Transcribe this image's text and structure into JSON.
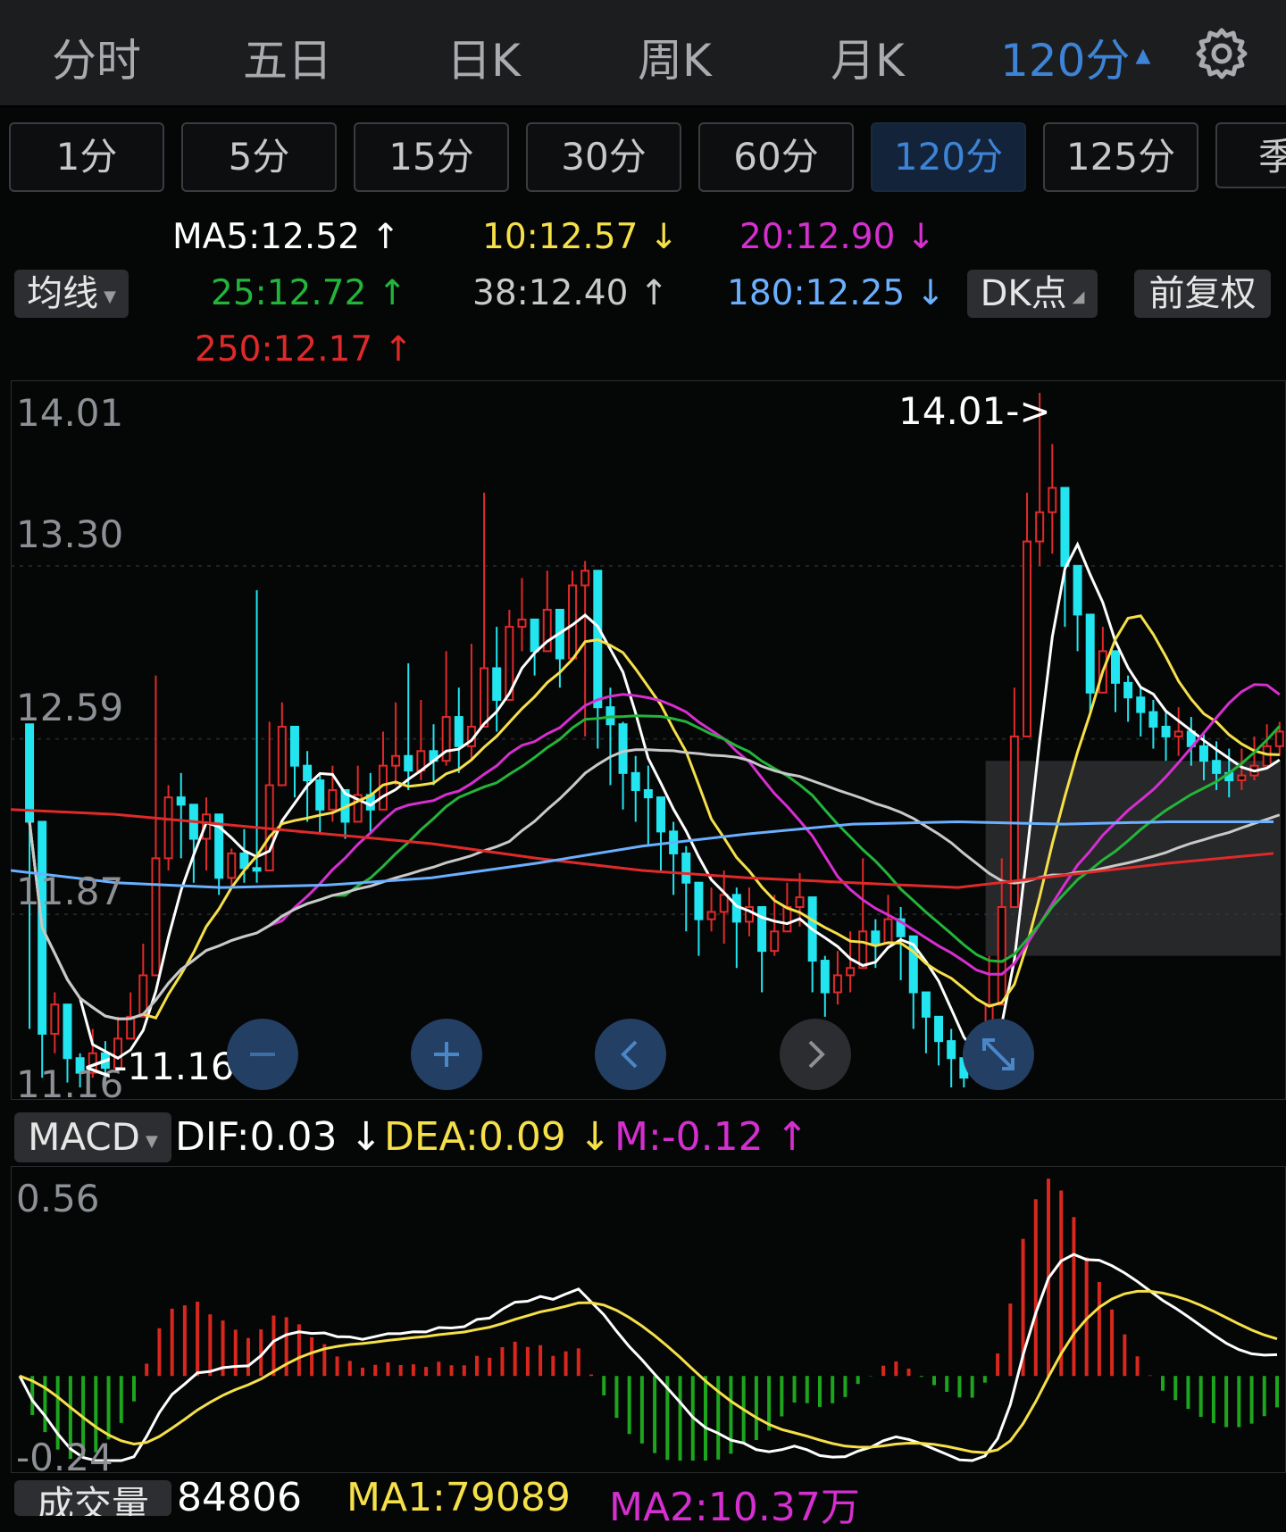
{
  "top_tabs": [
    {
      "label": "分时",
      "active": false
    },
    {
      "label": "五日",
      "active": false
    },
    {
      "label": "日K",
      "active": false
    },
    {
      "label": "周K",
      "active": false
    },
    {
      "label": "月K",
      "active": false
    },
    {
      "label": "120分",
      "active": true
    }
  ],
  "top_caret": "▲",
  "gear_icon": "gear-icon",
  "periods": [
    {
      "label": "1分",
      "active": false
    },
    {
      "label": "5分",
      "active": false
    },
    {
      "label": "15分",
      "active": false
    },
    {
      "label": "30分",
      "active": false
    },
    {
      "label": "60分",
      "active": false
    },
    {
      "label": "120分",
      "active": true
    },
    {
      "label": "125分",
      "active": false
    },
    {
      "label": "季",
      "active": false
    }
  ],
  "ma_legend": {
    "ma5": {
      "text": "MA5:12.52",
      "arrow": "↑",
      "color": "#ffffff"
    },
    "ma10": {
      "text": "10:12.57",
      "arrow": "↓",
      "color": "#f5e04a"
    },
    "ma20": {
      "text": "20:12.90",
      "arrow": "↓",
      "color": "#d52fd0"
    },
    "ma25": {
      "text": "25:12.72",
      "arrow": "↑",
      "color": "#23b53a"
    },
    "ma38": {
      "text": "38:12.40",
      "arrow": "↑",
      "color": "#c9c9c9"
    },
    "ma180": {
      "text": "180:12.25",
      "arrow": "↓",
      "color": "#6ab0ff"
    },
    "ma250": {
      "text": "250:12.17",
      "arrow": "↑",
      "color": "#e02a2a"
    }
  },
  "controls": {
    "avg_line": "均线",
    "dk_point": "DK点",
    "fq": "前复权"
  },
  "main_chart": {
    "y_labels": [
      "14.01",
      "13.30",
      "12.59",
      "11.87",
      "11.16"
    ],
    "max_marker": "14.01->",
    "min_marker": "<-11.16"
  },
  "nav_icons": [
    "minus-icon",
    "plus-icon",
    "chevron-left-icon",
    "chevron-right-icon",
    "expand-icon"
  ],
  "macd": {
    "name": "MACD",
    "dif": {
      "text": "DIF:0.03",
      "arrow": "↓",
      "color": "#ffffff"
    },
    "dea": {
      "text": "DEA:0.09",
      "arrow": "↓",
      "color": "#f5e04a"
    },
    "m": {
      "text": "M:-0.12",
      "arrow": "↑",
      "color": "#d52fd0"
    },
    "y_top": "0.56",
    "y_bottom": "-0.24"
  },
  "volume": {
    "name": "成交量",
    "value": "84806",
    "ma1": "MA1:79089",
    "ma2": "MA2:10.37万"
  },
  "colors": {
    "up": "#e02a2a",
    "down": "#22e5f0",
    "accent": "#3d83d6",
    "macd_pos": "#d8281e",
    "macd_neg": "#1ea51e"
  },
  "chart_data": {
    "type": "candlestick",
    "y_range": [
      11.16,
      14.01
    ],
    "high_marker": 14.01,
    "low_marker": 11.16,
    "ma_last": {
      "MA5": 12.52,
      "MA10": 12.57,
      "MA20": 12.9,
      "MA25": 12.72,
      "MA38": 12.4,
      "MA180": 12.25,
      "MA250": 12.17
    },
    "macd_last": {
      "DIF": 0.03,
      "DEA": 0.09,
      "M": -0.12
    },
    "macd_range": [
      -0.24,
      0.56
    ],
    "closes": [
      12.25,
      11.38,
      11.5,
      11.28,
      11.22,
      11.3,
      11.24,
      11.36,
      11.45,
      11.62,
      12.1,
      12.35,
      12.32,
      12.18,
      12.28,
      12.02,
      12.12,
      12.06,
      12.05,
      12.4,
      12.64,
      12.48,
      12.42,
      12.3,
      12.38,
      12.25,
      12.36,
      12.3,
      12.48,
      12.52,
      12.46,
      12.54,
      12.5,
      12.68,
      12.56,
      12.64,
      12.88,
      12.75,
      13.05,
      13.08,
      12.95,
      13.12,
      12.92,
      13.22,
      13.28,
      12.72,
      12.65,
      12.45,
      12.38,
      12.35,
      12.21,
      12.12,
      12.0,
      11.85,
      11.88,
      11.95,
      11.84,
      11.9,
      11.72,
      11.8,
      11.9,
      11.94,
      11.68,
      11.55,
      11.62,
      11.65,
      11.8,
      11.75,
      11.85,
      11.78,
      11.55,
      11.45,
      11.35,
      11.28,
      11.2,
      11.22,
      11.5,
      11.9,
      12.6,
      13.4,
      13.52,
      13.62,
      13.3,
      13.1,
      12.78,
      12.95,
      12.82,
      12.76,
      12.7,
      12.64,
      12.6,
      12.62,
      12.56,
      12.5,
      12.45,
      12.42,
      12.44,
      12.48,
      12.56,
      12.62
    ],
    "highs": [
      12.3,
      11.55,
      11.55,
      11.4,
      11.3,
      11.4,
      11.35,
      11.45,
      11.55,
      11.75,
      12.85,
      12.4,
      12.45,
      12.32,
      12.35,
      12.12,
      12.14,
      12.22,
      13.2,
      12.66,
      12.74,
      12.5,
      12.54,
      12.45,
      12.48,
      12.38,
      12.48,
      12.45,
      12.62,
      12.74,
      12.9,
      12.75,
      12.65,
      12.95,
      12.8,
      12.98,
      13.6,
      13.05,
      13.12,
      13.25,
      13.05,
      13.28,
      13.05,
      13.28,
      13.32,
      12.92,
      12.8,
      12.66,
      12.52,
      12.48,
      12.35,
      12.25,
      12.15,
      11.95,
      11.98,
      12.05,
      11.98,
      11.98,
      11.85,
      11.95,
      12.0,
      12.04,
      11.8,
      11.7,
      11.72,
      11.8,
      12.1,
      11.85,
      11.95,
      11.9,
      11.65,
      11.55,
      11.45,
      11.4,
      11.3,
      11.35,
      11.7,
      12.1,
      12.8,
      13.6,
      14.01,
      13.8,
      13.4,
      13.2,
      13.0,
      13.05,
      12.95,
      12.85,
      12.8,
      12.75,
      12.7,
      12.72,
      12.68,
      12.62,
      12.58,
      12.55,
      12.55,
      12.6,
      12.65,
      12.66
    ],
    "lows": [
      11.4,
      11.2,
      11.3,
      11.18,
      11.16,
      11.2,
      11.18,
      11.28,
      11.38,
      11.55,
      11.9,
      12.05,
      12.1,
      12.0,
      12.05,
      11.95,
      11.98,
      12.0,
      12.0,
      12.2,
      12.4,
      12.35,
      12.25,
      12.2,
      12.25,
      12.18,
      12.25,
      12.2,
      12.35,
      12.4,
      12.38,
      12.42,
      12.4,
      12.48,
      12.45,
      12.5,
      12.7,
      12.62,
      12.88,
      12.95,
      12.85,
      12.95,
      12.8,
      13.08,
      12.6,
      12.55,
      12.4,
      12.3,
      12.25,
      12.15,
      12.05,
      11.95,
      11.8,
      11.7,
      11.8,
      11.75,
      11.65,
      11.78,
      11.55,
      11.7,
      11.8,
      11.82,
      11.55,
      11.45,
      11.5,
      11.55,
      11.7,
      11.65,
      11.75,
      11.6,
      11.4,
      11.3,
      11.25,
      11.16,
      11.16,
      11.18,
      11.4,
      11.85,
      12.55,
      13.2,
      13.3,
      13.35,
      13.05,
      12.95,
      12.7,
      12.8,
      12.7,
      12.66,
      12.6,
      12.55,
      12.5,
      12.52,
      12.48,
      12.42,
      12.38,
      12.35,
      12.38,
      12.42,
      12.48,
      12.52
    ]
  }
}
